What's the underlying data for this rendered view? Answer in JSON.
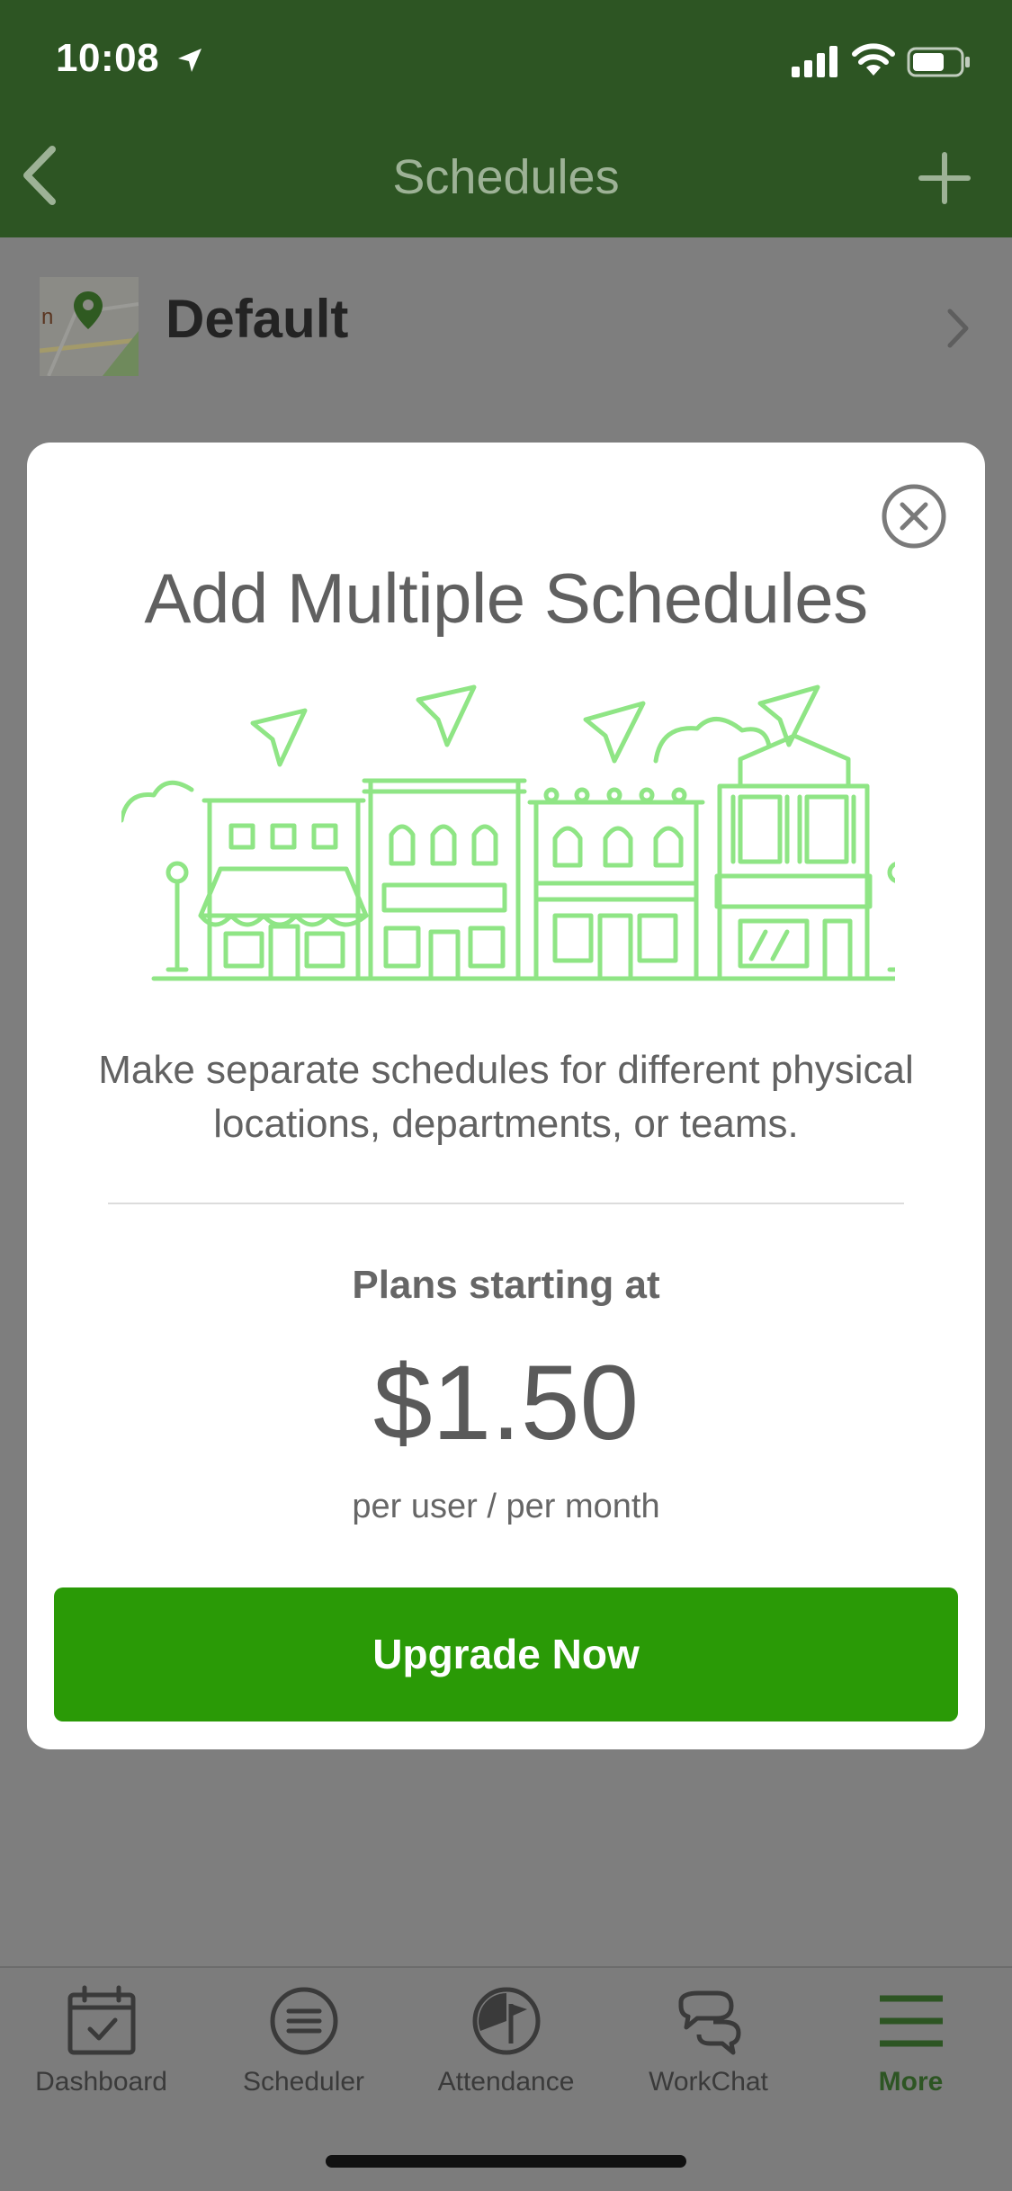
{
  "status_bar": {
    "time": "10:08"
  },
  "nav": {
    "title": "Schedules"
  },
  "list": {
    "items": [
      {
        "label": "Default"
      }
    ]
  },
  "modal": {
    "title": "Add Multiple Schedules",
    "description": "Make separate schedules for different physical locations, departments, or teams.",
    "plans_label": "Plans starting at",
    "price": "$1.50",
    "price_unit": "per user / per month",
    "cta": "Upgrade Now"
  },
  "tabs": [
    {
      "label": "Dashboard",
      "icon": "calendar-check-icon",
      "active": false
    },
    {
      "label": "Scheduler",
      "icon": "list-circle-icon",
      "active": false
    },
    {
      "label": "Attendance",
      "icon": "clock-flag-icon",
      "active": false
    },
    {
      "label": "WorkChat",
      "icon": "chat-bubbles-icon",
      "active": false
    },
    {
      "label": "More",
      "icon": "hamburger-icon",
      "active": true
    }
  ],
  "colors": {
    "brand_green": "#2a9a06",
    "nav_green_dimmed": "#2d5523",
    "illustration_green": "#8fe585"
  }
}
